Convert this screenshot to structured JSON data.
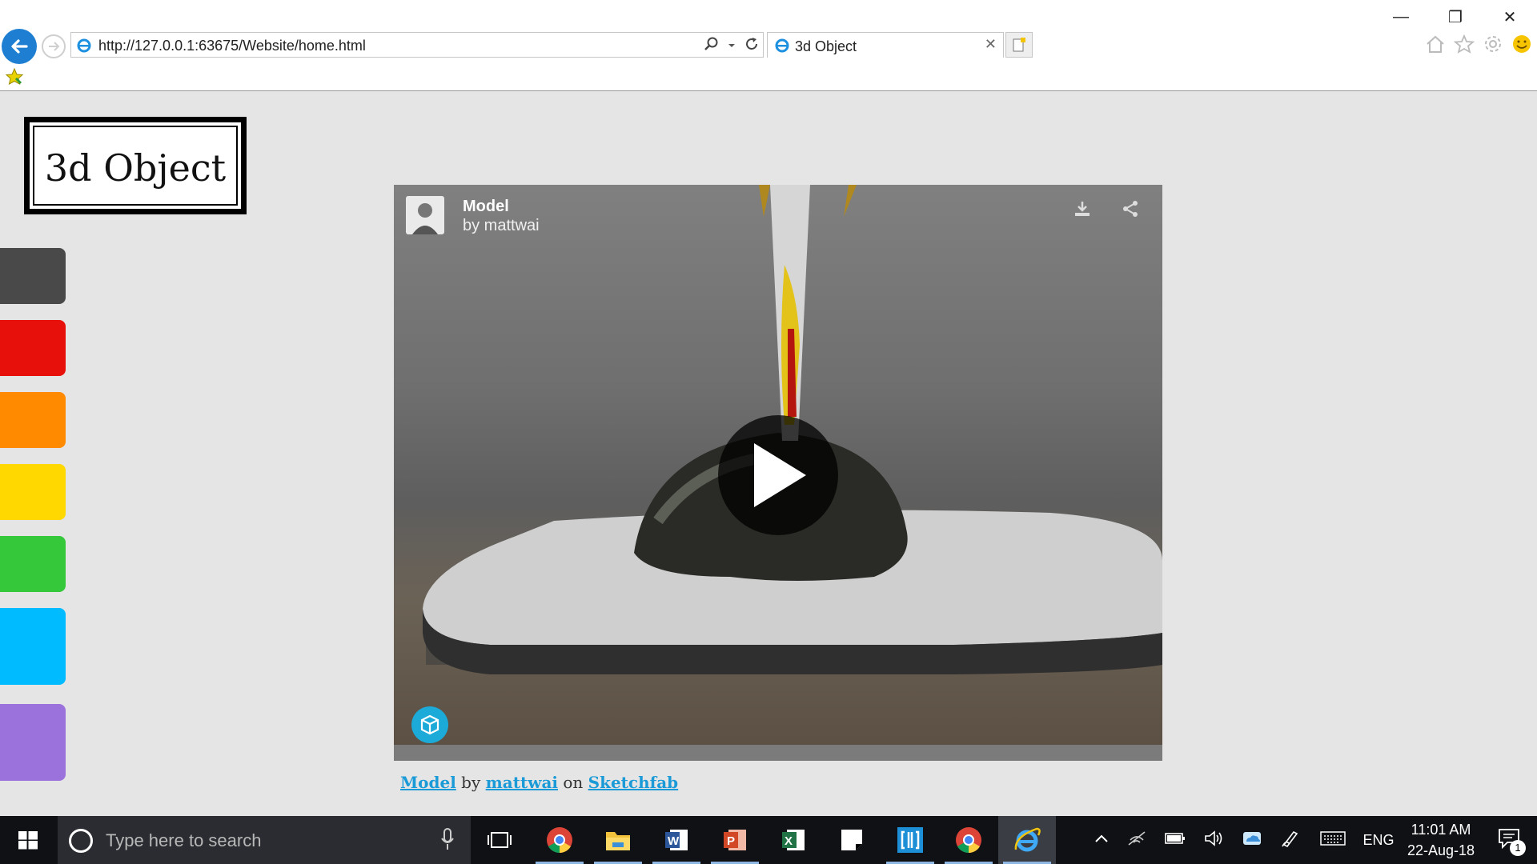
{
  "browser": {
    "url": "http://127.0.0.1:63675/Website/home.html",
    "tab_title": "3d Object"
  },
  "page": {
    "logo_text": "3d Object",
    "swatches": [
      "#4a4949",
      "#e8100b",
      "#ff8a00",
      "#ffd800",
      "#35c83b",
      "#00bbff",
      "#9b72dc"
    ]
  },
  "viewer": {
    "model_title": "Model",
    "model_author": "by mattwai"
  },
  "credit": {
    "model_link": "Model",
    "by": "by",
    "author_link": "mattwai",
    "on": "on",
    "site_link": "Sketchfab"
  },
  "taskbar": {
    "search_placeholder": "Type here to search",
    "language": "ENG",
    "time": "11:01 AM",
    "date": "22-Aug-18",
    "notification_count": "1"
  },
  "colors": {
    "accent": "#1e7fd2",
    "link": "#1a9bd7"
  }
}
